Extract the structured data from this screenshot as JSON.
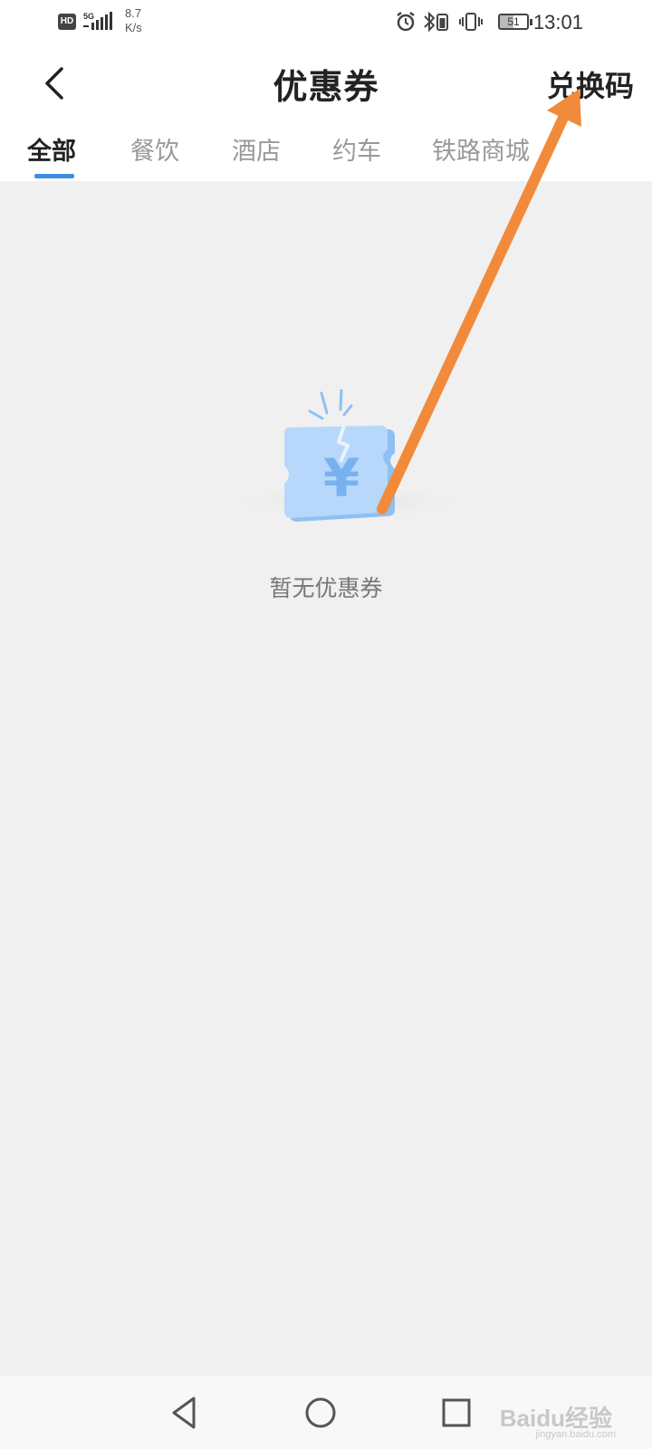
{
  "status_bar": {
    "hd": "HD",
    "network": "5G",
    "speed_value": "8.7",
    "speed_unit": "K/s",
    "battery": "51",
    "time": "13:01"
  },
  "header": {
    "title": "优惠券",
    "action_label": "兑换码"
  },
  "tabs": [
    {
      "label": "全部",
      "active": true
    },
    {
      "label": "餐饮",
      "active": false
    },
    {
      "label": "酒店",
      "active": false
    },
    {
      "label": "约车",
      "active": false
    },
    {
      "label": "铁路商城",
      "active": false
    }
  ],
  "empty_state": {
    "icon": "coupon-yen-icon",
    "message": "暂无优惠券"
  },
  "annotation": {
    "color": "#f28a3c"
  },
  "colors": {
    "accent": "#3a8ee6",
    "background": "#f0f0f0"
  },
  "watermark": {
    "text": "Baidu经验",
    "sub": "jingyan.baidu.com"
  }
}
